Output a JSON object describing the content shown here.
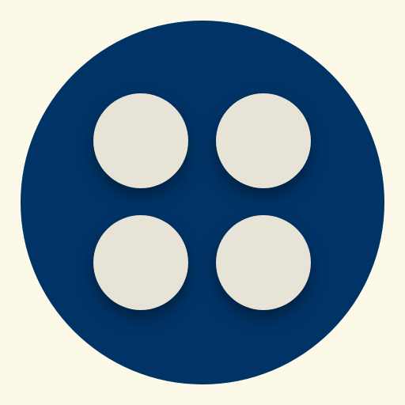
{
  "icon": {
    "name": "four-dots-grid-icon",
    "colors": {
      "background": "#FCF9E8",
      "circle": "#003366",
      "dots": "#E7E3D6"
    }
  }
}
